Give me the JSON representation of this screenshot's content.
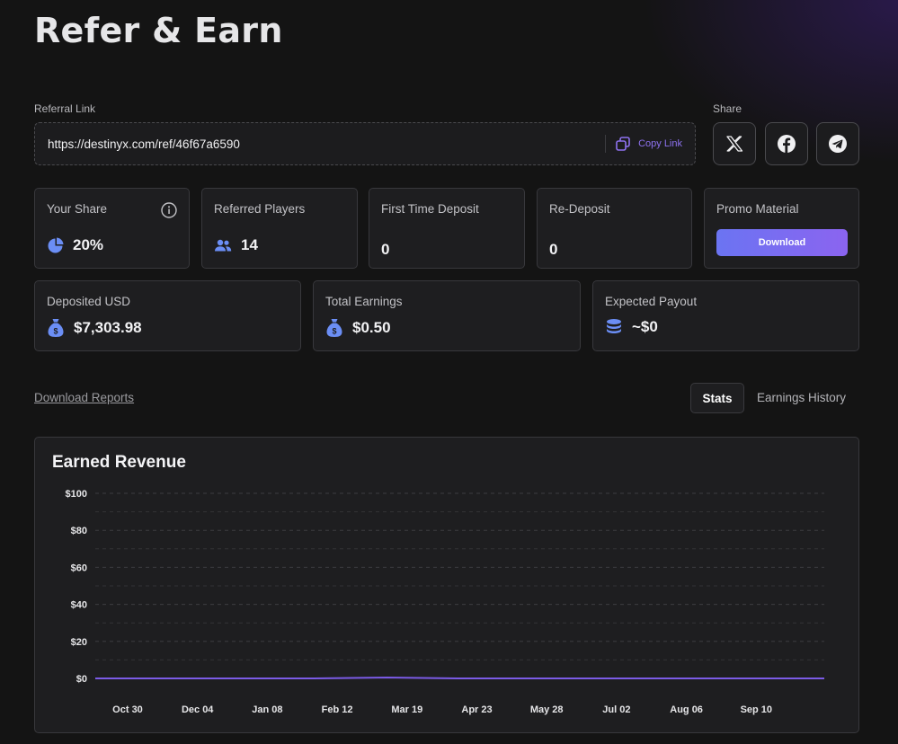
{
  "page": {
    "title": "Refer & Earn"
  },
  "referral": {
    "label": "Referral Link",
    "url": "https://destinyx.com/ref/46f67a6590",
    "copy_label": "Copy Link",
    "copy_icon": "copy-icon"
  },
  "share": {
    "label": "Share",
    "buttons": [
      {
        "icon": "x-twitter-icon"
      },
      {
        "icon": "facebook-icon"
      },
      {
        "icon": "telegram-icon"
      }
    ]
  },
  "stats": {
    "your_share": {
      "label": "Your Share",
      "value": "20%",
      "icon": "pie-chart-icon"
    },
    "referred_players": {
      "label": "Referred Players",
      "value": "14",
      "icon": "users-icon"
    },
    "first_time_deposit": {
      "label": "First Time Deposit",
      "value": "0"
    },
    "re_deposit": {
      "label": "Re-Deposit",
      "value": "0"
    },
    "promo_material": {
      "label": "Promo Material",
      "button_label": "Download"
    },
    "deposited_usd": {
      "label": "Deposited USD",
      "value": "$7,303.98",
      "icon": "money-bag-icon"
    },
    "total_earnings": {
      "label": "Total Earnings",
      "value": "$0.50",
      "icon": "money-bag-icon"
    },
    "expected_payout": {
      "label": "Expected Payout",
      "value": "~$0",
      "icon": "coins-icon"
    }
  },
  "reports": {
    "download_label": "Download Reports"
  },
  "tabs": [
    {
      "label": "Stats",
      "active": true
    },
    {
      "label": "Earnings History",
      "active": false
    }
  ],
  "colors": {
    "accent": "#8b64f0",
    "icon_blue": "#6b8ef5",
    "line": "#7b5be6"
  },
  "chart_data": {
    "type": "line",
    "title": "Earned Revenue",
    "xlabel": "",
    "ylabel": "",
    "x_ticks": [
      "Oct 30",
      "Dec 04",
      "Jan 08",
      "Feb 12",
      "Mar 19",
      "Apr 23",
      "May 28",
      "Jul 02",
      "Aug 06",
      "Sep 10"
    ],
    "y_ticks": [
      "$0",
      "$20",
      "$40",
      "$60",
      "$80",
      "$100"
    ],
    "ylim": [
      0,
      100
    ],
    "grid": true,
    "series": [
      {
        "values": [
          0,
          0,
          0,
          0,
          0.5,
          0,
          0,
          0,
          0,
          0,
          0
        ]
      }
    ]
  }
}
